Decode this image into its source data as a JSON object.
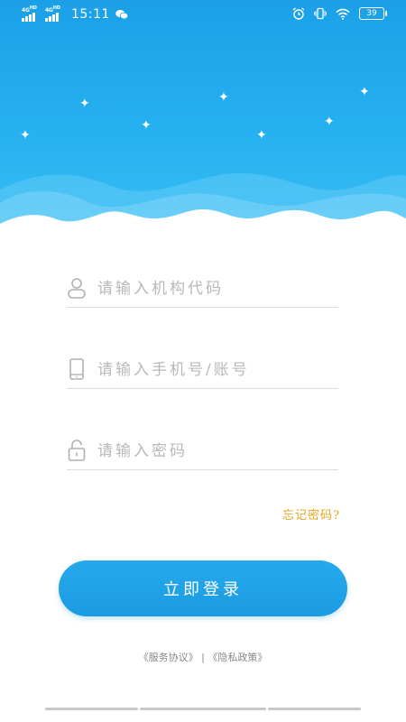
{
  "status_bar": {
    "network1": "4G",
    "network1_sup": "HD",
    "network2": "4G",
    "network2_sup": "HD",
    "time": "15:11",
    "app_icon": "wechat-icon",
    "alarm_icon": "alarm-icon",
    "vibrate_icon": "vibrate-icon",
    "wifi_icon": "wifi-icon",
    "battery": "39"
  },
  "form": {
    "org_code": {
      "placeholder": "请输入机构代码",
      "value": "",
      "icon": "user-icon"
    },
    "phone": {
      "placeholder": "请输入手机号/账号",
      "value": "",
      "icon": "phone-icon"
    },
    "password": {
      "placeholder": "请输入密码",
      "value": "",
      "icon": "lock-icon"
    },
    "forgot_label": "忘记密码?",
    "login_label": "立即登录"
  },
  "footer": {
    "service_agreement": "《服务协议》",
    "separator": "|",
    "privacy_policy": "《隐私政策》"
  },
  "theme": {
    "primary": "#1c9be2",
    "header_top": "#1ba0e8",
    "forgot_color": "#e3a41e"
  }
}
